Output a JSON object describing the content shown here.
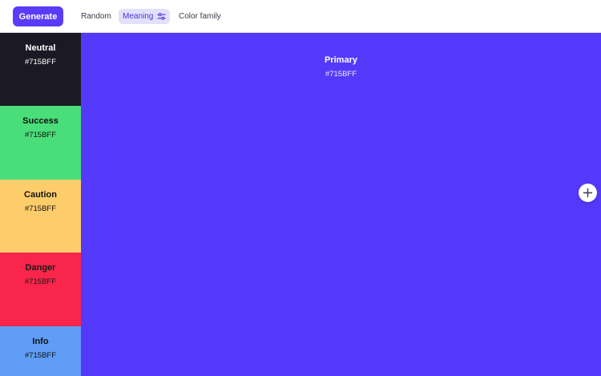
{
  "toolbar": {
    "generate_label": "Generate",
    "tabs": [
      {
        "label": "Random",
        "active": false
      },
      {
        "label": "Meaning",
        "active": true,
        "icon": "sliders-icon"
      },
      {
        "label": "Color family",
        "active": false
      }
    ]
  },
  "palette": {
    "sidebar": [
      {
        "name": "Neutral",
        "hex": "#715BFF",
        "color": "#1B1A24"
      },
      {
        "name": "Success",
        "hex": "#715BFF",
        "color": "#4ADE7A"
      },
      {
        "name": "Caution",
        "hex": "#715BFF",
        "color": "#FDCD6C"
      },
      {
        "name": "Danger",
        "hex": "#715BFF",
        "color": "#F9254A"
      },
      {
        "name": "Info",
        "hex": "#715BFF",
        "color": "#5F9DF6"
      }
    ],
    "primary": {
      "name": "Primary",
      "hex": "#715BFF",
      "color": "#5539FA"
    }
  },
  "actions": {
    "add_icon": "plus-icon"
  },
  "colors": {
    "accent": "#5A3BF8",
    "active_tab_bg": "#E3E0FC"
  }
}
